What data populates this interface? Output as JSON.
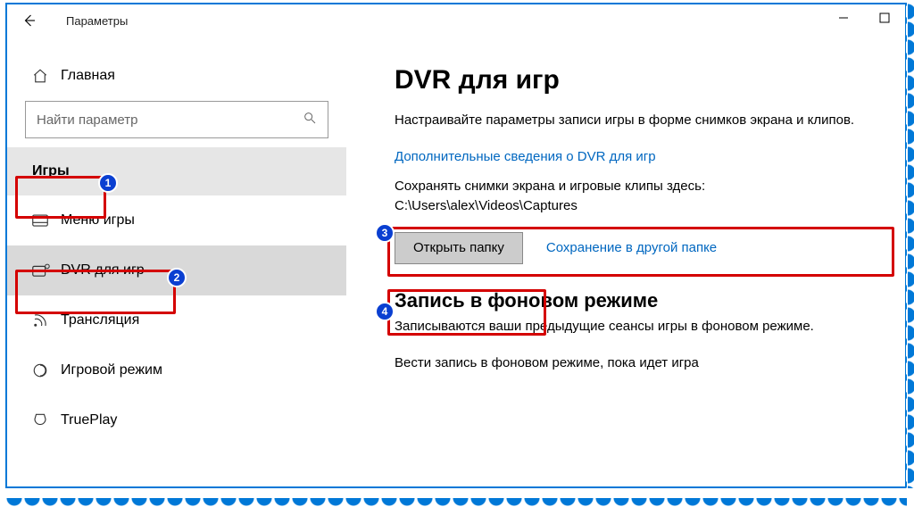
{
  "window": {
    "title": "Параметры"
  },
  "sidebar": {
    "home_label": "Главная",
    "search_placeholder": "Найти параметр",
    "category_label": "Игры",
    "items": [
      {
        "label": "Меню игры"
      },
      {
        "label": "DVR для игр"
      },
      {
        "label": "Трансляция"
      },
      {
        "label": "Игровой режим"
      },
      {
        "label": "TruePlay"
      }
    ]
  },
  "content": {
    "title": "DVR для игр",
    "description": "Настраивайте параметры записи игры в форме снимков экрана и клипов.",
    "more_info_link": "Дополнительные сведения о DVR для игр",
    "save_path_text": "Сохранять снимки экрана и игровые клипы здесь: C:\\Users\\alex\\Videos\\Captures",
    "open_folder_btn": "Открыть папку",
    "save_elsewhere_link": "Сохранение в другой папке",
    "bg_section_title": "Запись в фоновом режиме",
    "bg_section_desc": "Записываются ваши предыдущие сеансы игры в фоновом режиме.",
    "bg_toggle_label": "Вести запись в фоновом режиме, пока идет игра"
  },
  "annotations": {
    "b1": "1",
    "b2": "2",
    "b3": "3",
    "b4": "4"
  }
}
